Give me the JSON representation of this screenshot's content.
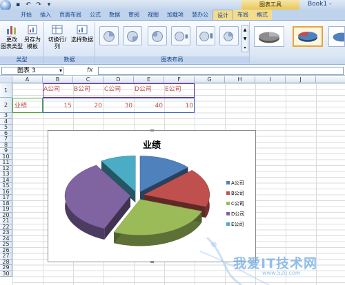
{
  "window": {
    "title": "Book1 -",
    "context_tab": "图表工具"
  },
  "tabs": [
    {
      "label": "开始"
    },
    {
      "label": "插入"
    },
    {
      "label": "页面布局"
    },
    {
      "label": "公式"
    },
    {
      "label": "数据"
    },
    {
      "label": "审阅"
    },
    {
      "label": "视图"
    },
    {
      "label": "加载项"
    },
    {
      "label": "慧办公"
    },
    {
      "label": "设计"
    },
    {
      "label": "布局"
    },
    {
      "label": "格式"
    }
  ],
  "ribbon": {
    "change_type": "更改\n图表类型",
    "save_template": "另存为\n模板",
    "group_type": "类型",
    "switch_rowcol": "切换行/列",
    "select_data": "选择数据",
    "group_data": "数据",
    "group_layout": "图表布局"
  },
  "formula": {
    "namebox": "图表 3",
    "fx": "fx"
  },
  "columns": [
    "A",
    "B",
    "C",
    "D",
    "E",
    "F",
    "G",
    "H",
    "I",
    "J"
  ],
  "rows": [
    "1",
    "2",
    "3",
    "4",
    "5",
    "6",
    "7",
    "8",
    "9",
    "10",
    "11",
    "12",
    "13",
    "14",
    "15",
    "16",
    "17",
    "18",
    "19",
    "20",
    "21",
    "22",
    "23",
    "24",
    "25",
    "26",
    "27",
    "28",
    "29",
    "30"
  ],
  "cells": {
    "b1": "A公司",
    "c1": "B公司",
    "d1": "C公司",
    "e1": "D公司",
    "f1": "E公司",
    "a2": "业绩",
    "b2": "15",
    "c2": "20",
    "d2": "30",
    "e2": "40",
    "f2": "10"
  },
  "chart_data": {
    "type": "pie",
    "title": "业绩",
    "categories": [
      "A公司",
      "B公司",
      "C公司",
      "D公司",
      "E公司"
    ],
    "values": [
      15,
      20,
      30,
      40,
      10
    ],
    "colors": [
      "#4f81bd",
      "#c0504d",
      "#9bbb59",
      "#8064a2",
      "#4bacc6"
    ],
    "legend": "right",
    "exploded": true,
    "style": "3d"
  },
  "watermark": {
    "text": "我爱IT技术网",
    "url": "www.52ij.com"
  }
}
